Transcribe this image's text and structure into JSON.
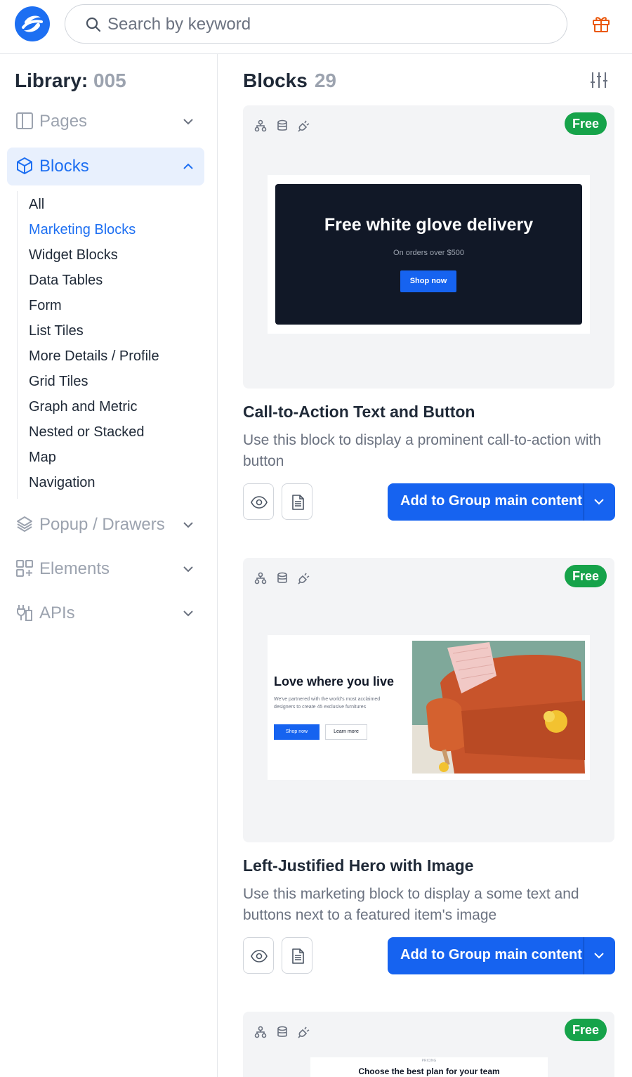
{
  "header": {
    "search_placeholder": "Search by keyword",
    "logo_icon": "brand-logo-icon",
    "gift_icon": "gift-icon",
    "accent_color": "#1d6ff2",
    "gift_color": "#ea580c"
  },
  "sidebar": {
    "library_label": "Library:",
    "library_number": "005",
    "sections": [
      {
        "label": "Pages",
        "icon": "panel-icon",
        "expanded": false
      },
      {
        "label": "Blocks",
        "icon": "cube-icon",
        "expanded": true,
        "active": true
      },
      {
        "label": "Popup / Drawers",
        "icon": "layers-icon",
        "expanded": false
      },
      {
        "label": "Elements",
        "icon": "grid-plus-icon",
        "expanded": false
      },
      {
        "label": "APIs",
        "icon": "plug-icon",
        "expanded": false
      }
    ],
    "block_categories": [
      "All",
      "Marketing Blocks",
      "Widget Blocks",
      "Data Tables",
      "Form",
      "List Tiles",
      "More Details / Profile",
      "Grid Tiles",
      "Graph and Metric",
      "Nested or Stacked",
      "Map",
      "Navigation"
    ],
    "selected_category": "Marketing Blocks"
  },
  "main": {
    "title": "Blocks",
    "count": "29",
    "filter_icon": "sliders-icon",
    "cards": [
      {
        "badge": "Free",
        "title": "Call-to-Action Text and Button",
        "description": "Use this block to display a prominent call-to-action with button",
        "add_label": "Add to Group main content",
        "preview": {
          "heading": "Free white glove delivery",
          "subheading": "On orders over $500",
          "button": "Shop now"
        }
      },
      {
        "badge": "Free",
        "title": "Left-Justified Hero with Image",
        "description": "Use this marketing block to display a some text and buttons next to a featured item's image",
        "add_label": "Add to Group main content",
        "preview": {
          "heading": "Love where you live",
          "subheading": "We've partnered with the world's most acclaimed designers to create 45 exclusive furnitures",
          "primary_button": "Shop now",
          "secondary_button": "Learn more"
        }
      },
      {
        "badge": "Free",
        "preview": {
          "kicker": "PRICING",
          "heading": "Choose the best plan for your team"
        }
      }
    ],
    "badge_color": "#16a34a",
    "button_color": "#1663f0"
  }
}
